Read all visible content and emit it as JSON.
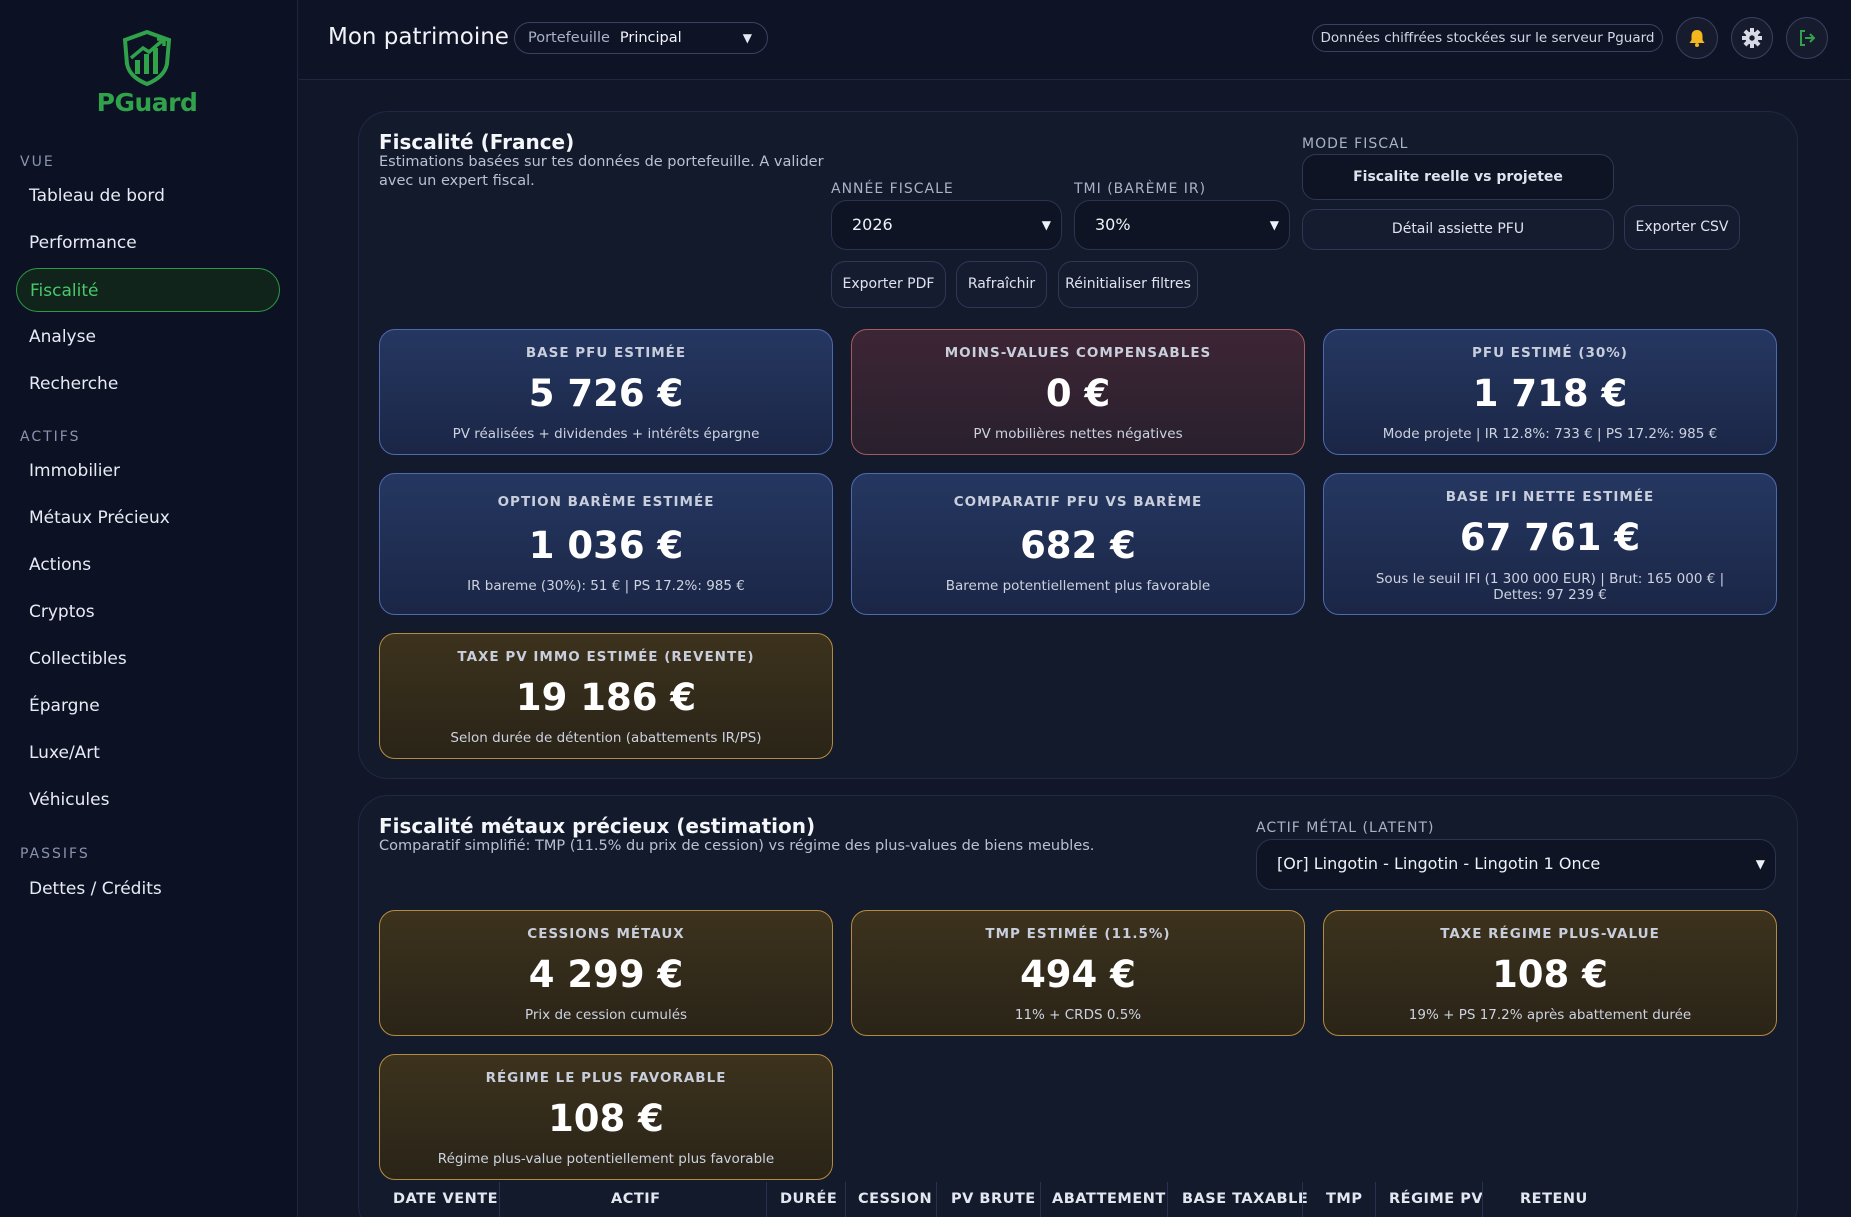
{
  "app": {
    "name": "PGuard"
  },
  "sidebar": {
    "sections": [
      {
        "label": "VUE",
        "items": [
          "Tableau de bord",
          "Performance",
          "Fiscalité",
          "Analyse",
          "Recherche"
        ]
      },
      {
        "label": "ACTIFS",
        "items": [
          "Immobilier",
          "Métaux Précieux",
          "Actions",
          "Cryptos",
          "Collectibles",
          "Épargne",
          "Luxe/Art",
          "Véhicules"
        ]
      },
      {
        "label": "PASSIFS",
        "items": [
          "Dettes / Crédits"
        ]
      }
    ],
    "active_item": "Fiscalité"
  },
  "header": {
    "title": "Mon patrimoine",
    "portfolio_label": "Portefeuille",
    "portfolio_value": "Principal",
    "storage_badge": "Données chiffrées stockées sur le serveur Pguard",
    "icons": [
      "bell-icon",
      "gear-icon",
      "logout-icon"
    ]
  },
  "fiscal": {
    "title": "Fiscalité (France)",
    "subtitle": "Estimations basées sur tes données de portefeuille. A valider avec un expert fiscal.",
    "year_label": "ANNÉE FISCALE",
    "year_value": "2026",
    "tmi_label": "TMI (BARÈME IR)",
    "tmi_value": "30%",
    "mode_label": "MODE FISCAL",
    "mode_button": "Fiscalite reelle vs projetee",
    "detail_button": "Détail assiette PFU",
    "export_csv": "Exporter CSV",
    "export_pdf": "Exporter PDF",
    "refresh": "Rafraîchir",
    "reset": "Réinitialiser filtres",
    "cards": [
      {
        "label": "BASE PFU ESTIMÉE",
        "value": "5 726 €",
        "note": "PV réalisées + dividendes + intérêts épargne"
      },
      {
        "label": "MOINS-VALUES COMPENSABLES",
        "value": "0 €",
        "note": "PV mobilières nettes négatives"
      },
      {
        "label": "PFU ESTIMÉ (30%)",
        "value": "1 718 €",
        "note": "Mode projete | IR 12.8%: 733 € | PS 17.2%: 985 €"
      },
      {
        "label": "OPTION BARÈME ESTIMÉE",
        "value": "1 036 €",
        "note": "IR bareme (30%): 51 € | PS 17.2%: 985 €"
      },
      {
        "label": "COMPARATIF PFU VS BARÈME",
        "value": "682 €",
        "note": "Bareme potentiellement plus favorable"
      },
      {
        "label": "BASE IFI NETTE ESTIMÉE",
        "value": "67 761 €",
        "note": "Sous le seuil IFI (1 300 000 EUR) | Brut: 165 000 € | Dettes: 97 239 €"
      },
      {
        "label": "TAXE PV IMMO ESTIMÉE (REVENTE)",
        "value": "19 186 €",
        "note": "Selon durée de détention (abattements IR/PS)"
      }
    ]
  },
  "metals": {
    "title": "Fiscalité métaux précieux (estimation)",
    "subtitle": "Comparatif simplifié: TMP (11.5% du prix de cession) vs régime des plus-values de biens meubles.",
    "asset_label": "ACTIF MÉTAL (LATENT)",
    "asset_value": "[Or] Lingotin - Lingotin - Lingotin 1 Once",
    "cards": [
      {
        "label": "CESSIONS MÉTAUX",
        "value": "4 299 €",
        "note": "Prix de cession cumulés"
      },
      {
        "label": "TMP ESTIMÉE (11.5%)",
        "value": "494 €",
        "note": "11% + CRDS 0.5%"
      },
      {
        "label": "TAXE RÉGIME PLUS-VALUE",
        "value": "108 €",
        "note": "19% + PS 17.2% après abattement durée"
      },
      {
        "label": "RÉGIME LE PLUS FAVORABLE",
        "value": "108 €",
        "note": "Régime plus-value potentiellement plus favorable"
      }
    ],
    "table_headers": [
      "DATE VENTE",
      "ACTIF",
      "DURÉE",
      "CESSION",
      "PV BRUTE",
      "ABATTEMENT",
      "BASE TAXABLE",
      "TMP",
      "RÉGIME PV",
      "RETENU"
    ]
  },
  "colors": {
    "accent": "#2fa24a",
    "card_blue": "#223158",
    "card_red": "#382332",
    "card_gold": "#352d1c"
  }
}
